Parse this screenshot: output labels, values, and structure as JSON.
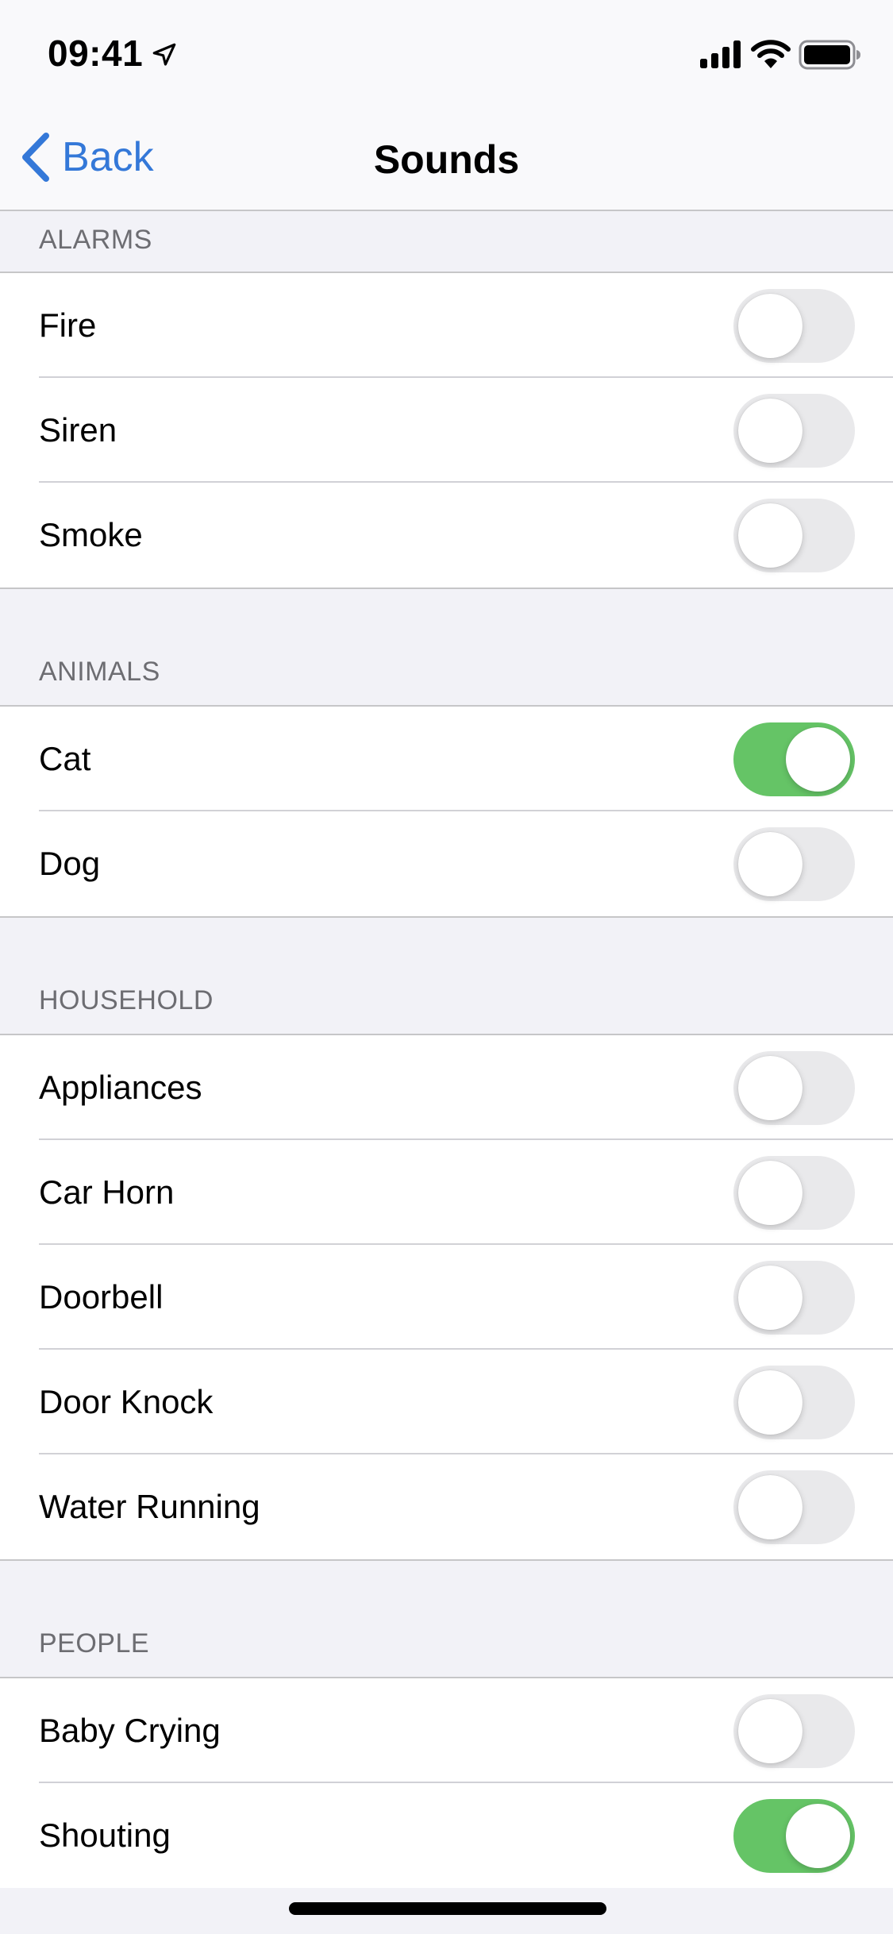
{
  "status_bar": {
    "time": "09:41",
    "icons": [
      "location-arrow-icon",
      "cellular-signal-icon",
      "wifi-icon",
      "battery-icon"
    ]
  },
  "nav": {
    "back_label": "Back",
    "title": "Sounds"
  },
  "colors": {
    "accent": "#3478d8",
    "toggle_on": "#65c466",
    "toggle_off": "#e9e9eb",
    "grouped_background": "#f2f2f7",
    "section_header_text": "#6d6d72"
  },
  "sections": [
    {
      "header": "ALARMS",
      "items": [
        {
          "label": "Fire",
          "on": false
        },
        {
          "label": "Siren",
          "on": false
        },
        {
          "label": "Smoke",
          "on": false
        }
      ]
    },
    {
      "header": "ANIMALS",
      "items": [
        {
          "label": "Cat",
          "on": true
        },
        {
          "label": "Dog",
          "on": false
        }
      ]
    },
    {
      "header": "HOUSEHOLD",
      "items": [
        {
          "label": "Appliances",
          "on": false
        },
        {
          "label": "Car Horn",
          "on": false
        },
        {
          "label": "Doorbell",
          "on": false
        },
        {
          "label": "Door Knock",
          "on": false
        },
        {
          "label": "Water Running",
          "on": false
        }
      ]
    },
    {
      "header": "PEOPLE",
      "items": [
        {
          "label": "Baby Crying",
          "on": false
        },
        {
          "label": "Shouting",
          "on": true
        }
      ]
    }
  ]
}
